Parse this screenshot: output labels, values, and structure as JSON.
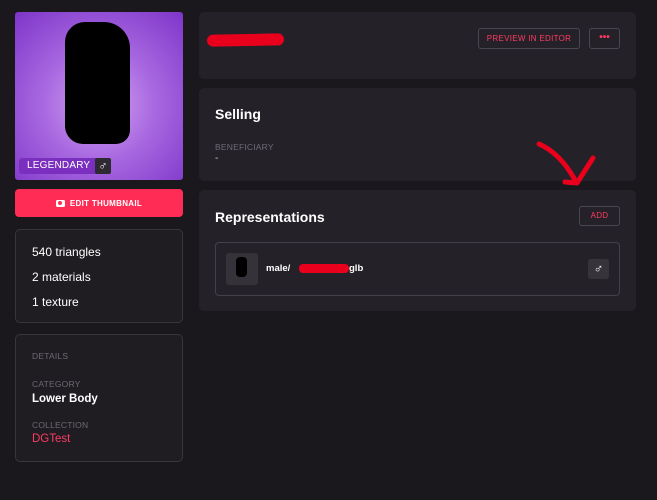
{
  "thumbnail": {
    "rarity_badge": "LEGENDARY",
    "gender_symbol": "♂",
    "gradient_colors": [
      "#d3a5f2",
      "#a868e0",
      "#7d35c9"
    ]
  },
  "edit_thumbnail_button": {
    "label": "EDIT THUMBNAIL",
    "icon": "camera-icon",
    "color": "#ff2d55"
  },
  "stats": [
    "540 triangles",
    "2 materials",
    "1 texture"
  ],
  "details": {
    "heading": "DETAILS",
    "category_label": "CATEGORY",
    "category_value": "Lower Body",
    "collection_label": "COLLECTION",
    "collection_value": "DGTest"
  },
  "header": {
    "item_name": "",
    "preview_button": "PREVIEW IN EDITOR",
    "more_button": "•••"
  },
  "selling": {
    "title": "Selling",
    "beneficiary_label": "BENEFICIARY",
    "beneficiary_value": "-"
  },
  "representations": {
    "title": "Representations",
    "add_button": "ADD",
    "items": [
      {
        "file_prefix": "male/",
        "file_suffix": "glb",
        "gender_symbol": "♂"
      }
    ]
  },
  "colors": {
    "accent": "#ff2d55",
    "link": "#ff3a63",
    "background": "#1a181d",
    "panel": "#242228",
    "redaction": "#e8001c",
    "rarity_legendary": "#7a2fbf"
  }
}
